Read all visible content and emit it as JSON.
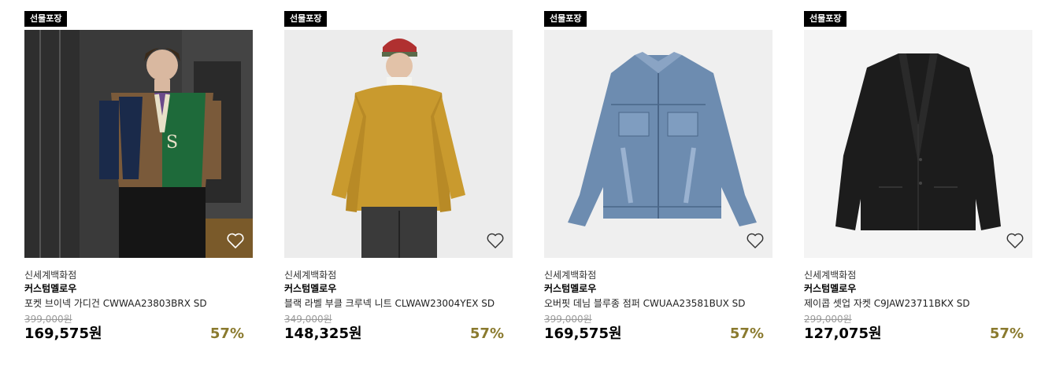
{
  "products": [
    {
      "badge": "선물포장",
      "store": "신세계백화점",
      "brand": "커스텀멜로우",
      "name": "포켓 브이넥 가디건 CWWAA23803BRX SD",
      "original_price": "399,000원",
      "price": "169,575원",
      "discount": "57%",
      "icon": "heart-outline-icon"
    },
    {
      "badge": "선물포장",
      "store": "신세계백화점",
      "brand": "커스텀멜로우",
      "name": "블랙 라벨 부클 크루넥 니트 CLWAW23004YEX SD",
      "original_price": "349,000원",
      "price": "148,325원",
      "discount": "57%",
      "icon": "heart-outline-icon"
    },
    {
      "badge": "선물포장",
      "store": "신세계백화점",
      "brand": "커스텀멜로우",
      "name": "오버핏 데님 블루종 점퍼 CWUAA23581BUX SD",
      "original_price": "399,000원",
      "price": "169,575원",
      "discount": "57%",
      "icon": "heart-outline-icon"
    },
    {
      "badge": "선물포장",
      "store": "신세계백화점",
      "brand": "커스텀멜로우",
      "name": "제이콥 셋업 자켓 C9JAW23711BKX SD",
      "original_price": "299,000원",
      "price": "127,075원",
      "discount": "57%",
      "icon": "heart-outline-icon"
    }
  ],
  "colors": {
    "discount": "#8a7a2e",
    "badge_bg": "#000000",
    "original_price": "#999999"
  }
}
